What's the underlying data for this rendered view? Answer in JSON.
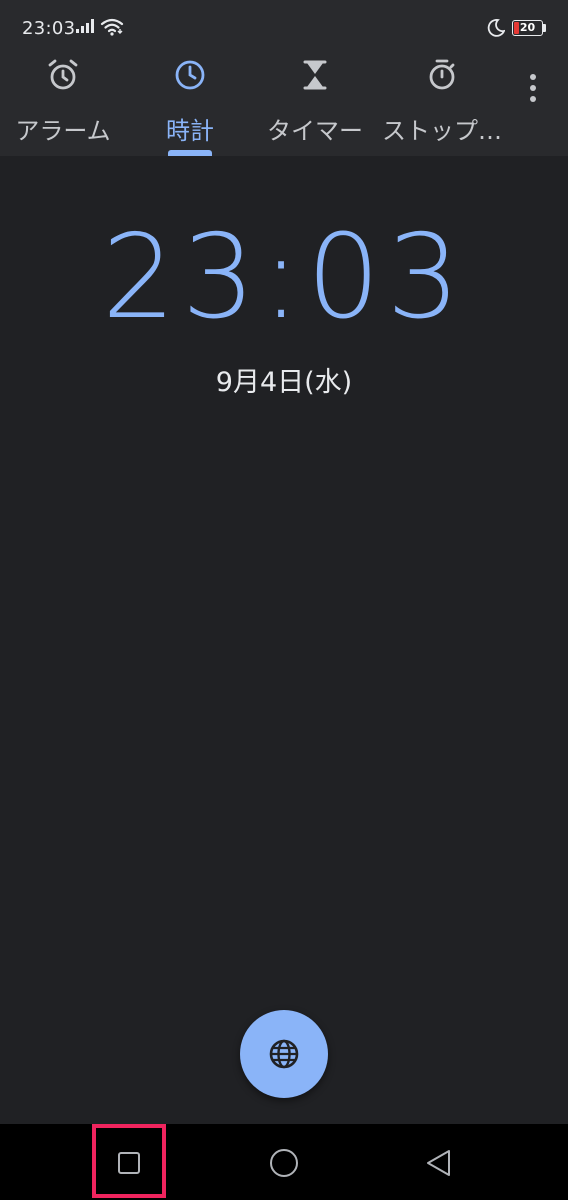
{
  "status_bar": {
    "time": "23:03",
    "battery_level": "20",
    "icons": [
      "signal-icon",
      "wifi-icon",
      "moon-icon",
      "battery-icon"
    ]
  },
  "tabs": [
    {
      "label": "アラーム",
      "icon": "alarm-clock-icon",
      "active": false
    },
    {
      "label": "時計",
      "icon": "clock-icon",
      "active": true
    },
    {
      "label": "タイマー",
      "icon": "hourglass-icon",
      "active": false
    },
    {
      "label": "ストップ…",
      "icon": "stopwatch-icon",
      "active": false
    }
  ],
  "clock": {
    "time": "23:03",
    "date": "9月4日(水)"
  },
  "fab": {
    "icon": "globe-icon"
  },
  "nav": {
    "buttons": [
      "recents-square-icon",
      "home-circle-icon",
      "back-triangle-icon"
    ]
  },
  "colors": {
    "background": "#202124",
    "toolbar": "#292a2d",
    "accent": "#8ab4f8",
    "highlight": "#f0245e",
    "battery_low": "#e53935"
  }
}
